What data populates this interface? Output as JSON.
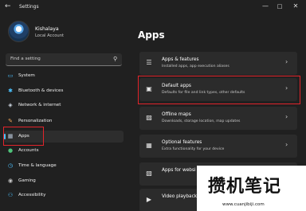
{
  "window": {
    "title": "Settings",
    "back_icon": "back-arrow-icon"
  },
  "user": {
    "name": "Kishalaya",
    "account": "Local Account"
  },
  "search": {
    "placeholder": "Find a setting"
  },
  "sidebar": {
    "items": [
      {
        "label": "System",
        "icon": "monitor-icon",
        "color": "#4cc2ff"
      },
      {
        "label": "Bluetooth & devices",
        "icon": "bluetooth-icon",
        "color": "#4cc2ff"
      },
      {
        "label": "Network & internet",
        "icon": "network-icon",
        "color": "#cfd8e3"
      },
      {
        "label": "Personalization",
        "icon": "brush-icon",
        "color": "#f2a65a"
      },
      {
        "label": "Apps",
        "icon": "apps-icon",
        "color": "#b8c7d9",
        "active": true
      },
      {
        "label": "Accounts",
        "icon": "person-icon",
        "color": "#4fc37a"
      },
      {
        "label": "Time & language",
        "icon": "globe-clock-icon",
        "color": "#4cc2ff"
      },
      {
        "label": "Gaming",
        "icon": "gamepad-icon",
        "color": "#c9c9c9"
      },
      {
        "label": "Accessibility",
        "icon": "accessibility-icon",
        "color": "#4cc2ff"
      }
    ]
  },
  "main": {
    "title": "Apps",
    "cards": [
      {
        "title": "Apps & features",
        "subtitle": "Installed apps, app execution aliases",
        "icon": "apps-list-icon"
      },
      {
        "title": "Default apps",
        "subtitle": "Defaults for file and link types, other defaults",
        "icon": "default-apps-icon"
      },
      {
        "title": "Offline maps",
        "subtitle": "Downloads, storage location, map updates",
        "icon": "map-icon"
      },
      {
        "title": "Optional features",
        "subtitle": "Extra functionality for your device",
        "icon": "optional-features-icon"
      },
      {
        "title": "Apps for websi",
        "subtitle": "",
        "icon": "web-apps-icon"
      },
      {
        "title": "Video playback",
        "subtitle": "",
        "icon": "video-icon"
      }
    ]
  },
  "watermark": {
    "main": "攒机笔记",
    "sub": "www.cuanjibiji.com"
  },
  "colors": {
    "accent": "#4cc2ff",
    "highlight_box": "#e2242b"
  }
}
